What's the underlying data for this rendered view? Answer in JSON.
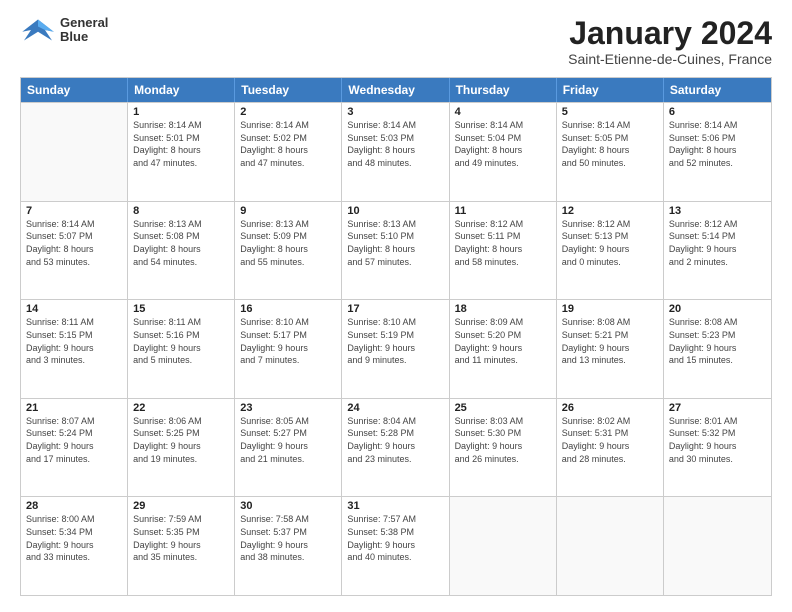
{
  "logo": {
    "line1": "General",
    "line2": "Blue"
  },
  "title": "January 2024",
  "subtitle": "Saint-Etienne-de-Cuines, France",
  "headers": [
    "Sunday",
    "Monday",
    "Tuesday",
    "Wednesday",
    "Thursday",
    "Friday",
    "Saturday"
  ],
  "weeks": [
    [
      {
        "day": "",
        "info": ""
      },
      {
        "day": "1",
        "info": "Sunrise: 8:14 AM\nSunset: 5:01 PM\nDaylight: 8 hours\nand 47 minutes."
      },
      {
        "day": "2",
        "info": "Sunrise: 8:14 AM\nSunset: 5:02 PM\nDaylight: 8 hours\nand 47 minutes."
      },
      {
        "day": "3",
        "info": "Sunrise: 8:14 AM\nSunset: 5:03 PM\nDaylight: 8 hours\nand 48 minutes."
      },
      {
        "day": "4",
        "info": "Sunrise: 8:14 AM\nSunset: 5:04 PM\nDaylight: 8 hours\nand 49 minutes."
      },
      {
        "day": "5",
        "info": "Sunrise: 8:14 AM\nSunset: 5:05 PM\nDaylight: 8 hours\nand 50 minutes."
      },
      {
        "day": "6",
        "info": "Sunrise: 8:14 AM\nSunset: 5:06 PM\nDaylight: 8 hours\nand 52 minutes."
      }
    ],
    [
      {
        "day": "7",
        "info": "Sunrise: 8:14 AM\nSunset: 5:07 PM\nDaylight: 8 hours\nand 53 minutes."
      },
      {
        "day": "8",
        "info": "Sunrise: 8:13 AM\nSunset: 5:08 PM\nDaylight: 8 hours\nand 54 minutes."
      },
      {
        "day": "9",
        "info": "Sunrise: 8:13 AM\nSunset: 5:09 PM\nDaylight: 8 hours\nand 55 minutes."
      },
      {
        "day": "10",
        "info": "Sunrise: 8:13 AM\nSunset: 5:10 PM\nDaylight: 8 hours\nand 57 minutes."
      },
      {
        "day": "11",
        "info": "Sunrise: 8:12 AM\nSunset: 5:11 PM\nDaylight: 8 hours\nand 58 minutes."
      },
      {
        "day": "12",
        "info": "Sunrise: 8:12 AM\nSunset: 5:13 PM\nDaylight: 9 hours\nand 0 minutes."
      },
      {
        "day": "13",
        "info": "Sunrise: 8:12 AM\nSunset: 5:14 PM\nDaylight: 9 hours\nand 2 minutes."
      }
    ],
    [
      {
        "day": "14",
        "info": "Sunrise: 8:11 AM\nSunset: 5:15 PM\nDaylight: 9 hours\nand 3 minutes."
      },
      {
        "day": "15",
        "info": "Sunrise: 8:11 AM\nSunset: 5:16 PM\nDaylight: 9 hours\nand 5 minutes."
      },
      {
        "day": "16",
        "info": "Sunrise: 8:10 AM\nSunset: 5:17 PM\nDaylight: 9 hours\nand 7 minutes."
      },
      {
        "day": "17",
        "info": "Sunrise: 8:10 AM\nSunset: 5:19 PM\nDaylight: 9 hours\nand 9 minutes."
      },
      {
        "day": "18",
        "info": "Sunrise: 8:09 AM\nSunset: 5:20 PM\nDaylight: 9 hours\nand 11 minutes."
      },
      {
        "day": "19",
        "info": "Sunrise: 8:08 AM\nSunset: 5:21 PM\nDaylight: 9 hours\nand 13 minutes."
      },
      {
        "day": "20",
        "info": "Sunrise: 8:08 AM\nSunset: 5:23 PM\nDaylight: 9 hours\nand 15 minutes."
      }
    ],
    [
      {
        "day": "21",
        "info": "Sunrise: 8:07 AM\nSunset: 5:24 PM\nDaylight: 9 hours\nand 17 minutes."
      },
      {
        "day": "22",
        "info": "Sunrise: 8:06 AM\nSunset: 5:25 PM\nDaylight: 9 hours\nand 19 minutes."
      },
      {
        "day": "23",
        "info": "Sunrise: 8:05 AM\nSunset: 5:27 PM\nDaylight: 9 hours\nand 21 minutes."
      },
      {
        "day": "24",
        "info": "Sunrise: 8:04 AM\nSunset: 5:28 PM\nDaylight: 9 hours\nand 23 minutes."
      },
      {
        "day": "25",
        "info": "Sunrise: 8:03 AM\nSunset: 5:30 PM\nDaylight: 9 hours\nand 26 minutes."
      },
      {
        "day": "26",
        "info": "Sunrise: 8:02 AM\nSunset: 5:31 PM\nDaylight: 9 hours\nand 28 minutes."
      },
      {
        "day": "27",
        "info": "Sunrise: 8:01 AM\nSunset: 5:32 PM\nDaylight: 9 hours\nand 30 minutes."
      }
    ],
    [
      {
        "day": "28",
        "info": "Sunrise: 8:00 AM\nSunset: 5:34 PM\nDaylight: 9 hours\nand 33 minutes."
      },
      {
        "day": "29",
        "info": "Sunrise: 7:59 AM\nSunset: 5:35 PM\nDaylight: 9 hours\nand 35 minutes."
      },
      {
        "day": "30",
        "info": "Sunrise: 7:58 AM\nSunset: 5:37 PM\nDaylight: 9 hours\nand 38 minutes."
      },
      {
        "day": "31",
        "info": "Sunrise: 7:57 AM\nSunset: 5:38 PM\nDaylight: 9 hours\nand 40 minutes."
      },
      {
        "day": "",
        "info": ""
      },
      {
        "day": "",
        "info": ""
      },
      {
        "day": "",
        "info": ""
      }
    ]
  ]
}
